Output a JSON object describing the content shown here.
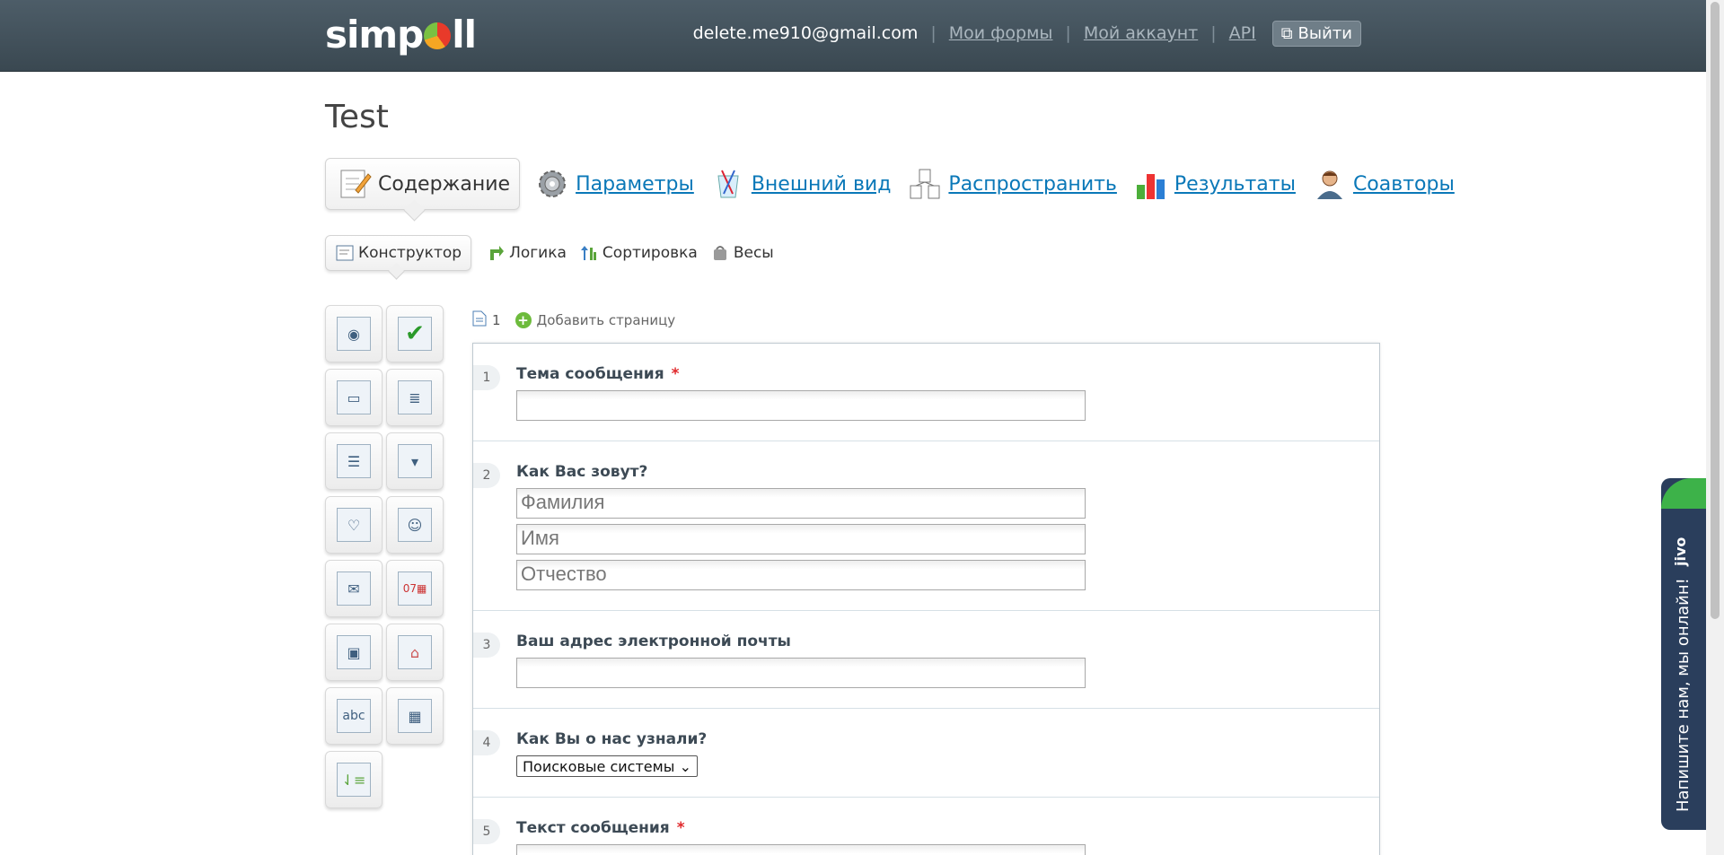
{
  "header": {
    "logo": "simpoll",
    "email": "delete.me910@gmail.com",
    "links": [
      "Мои формы",
      "Мой аккаунт",
      "API"
    ],
    "logout": "Выйти"
  },
  "page": {
    "title": "Test"
  },
  "tabs": [
    {
      "label": "Содержание",
      "icon": "edit-form-icon"
    },
    {
      "label": "Параметры",
      "icon": "gear-icon"
    },
    {
      "label": "Внешний вид",
      "icon": "paint-icon"
    },
    {
      "label": "Распространить",
      "icon": "share-icon"
    },
    {
      "label": "Результаты",
      "icon": "bar-chart-icon"
    },
    {
      "label": "Соавторы",
      "icon": "user-icon"
    }
  ],
  "subtabs": [
    {
      "label": "Конструктор"
    },
    {
      "label": "Логика"
    },
    {
      "label": "Сортировка"
    },
    {
      "label": "Весы"
    }
  ],
  "toolbox": [
    "radio-icon",
    "checkbox-icon",
    "text-field-icon",
    "text-area-icon",
    "list-icon",
    "dropdown-icon",
    "rating-icon",
    "contact-icon",
    "email-icon",
    "calendar-icon",
    "save-icon",
    "address-icon",
    "text-icon",
    "grid-icon",
    "sort-icon"
  ],
  "pagebar": {
    "page": "1",
    "add_page": "Добавить страницу"
  },
  "questions": [
    {
      "num": "1",
      "title": "Тема сообщения",
      "required": "*"
    },
    {
      "num": "2",
      "title": "Как Вас зовут?",
      "fields": [
        "Фамилия",
        "Имя",
        "Отчество"
      ]
    },
    {
      "num": "3",
      "title": "Ваш адрес электронной почты"
    },
    {
      "num": "4",
      "title": "Как Вы о нас узнали?",
      "select": "Поисковые системы"
    },
    {
      "num": "5",
      "title": "Текст сообщения",
      "required": "*"
    }
  ],
  "chat": {
    "brand": "jivo",
    "message": "Напишите нам, мы онлайн!"
  }
}
